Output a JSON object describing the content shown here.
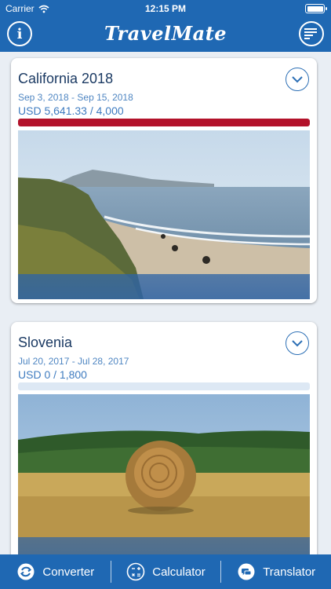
{
  "status_bar": {
    "carrier": "Carrier",
    "time": "12:15 PM"
  },
  "app": {
    "title": "TravelMate"
  },
  "colors": {
    "brand_blue": "#1f68b3",
    "over_budget_red": "#b3122a",
    "bar_track": "#dde8f4"
  },
  "trips": [
    {
      "name": "California 2018",
      "dates": "Sep 3, 2018 - Sep 15, 2018",
      "amount": "USD 5,641.33 / 4,000",
      "budget_used_fraction": 1.0,
      "photo": "coastal cliffs and beach"
    },
    {
      "name": "Slovenia",
      "dates": "Jul 20, 2017 - Jul 28, 2017",
      "amount": "USD 0 / 1,800",
      "budget_used_fraction": 0.0,
      "photo": "hay bale in a field"
    }
  ],
  "tabbar": [
    {
      "label": "Converter",
      "icon": "converter-icon"
    },
    {
      "label": "Calculator",
      "icon": "calculator-icon"
    },
    {
      "label": "Translator",
      "icon": "translator-icon"
    }
  ]
}
